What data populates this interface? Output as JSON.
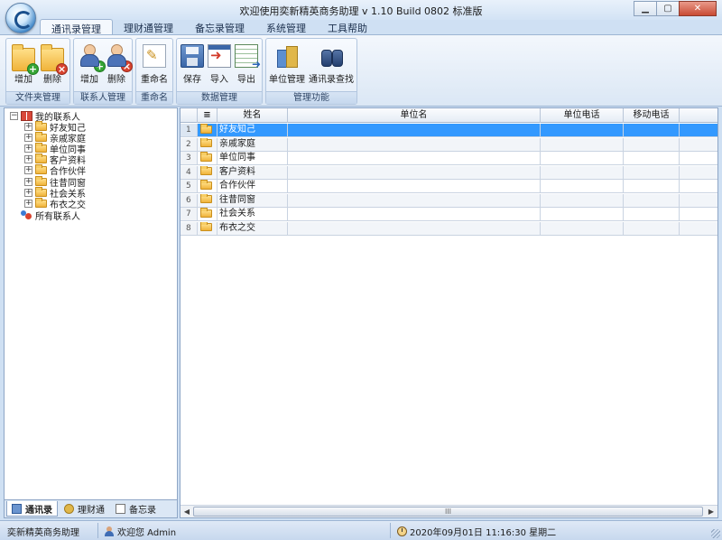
{
  "window": {
    "title": "欢迎使用奕新精英商务助理  v 1.10 Build 0802  标准版",
    "controls": {
      "minimize": "▁",
      "maximize": "▢",
      "close": "✕"
    }
  },
  "ribbon": {
    "tabs": [
      "通讯录管理",
      "理财通管理",
      "备忘录管理",
      "系统管理",
      "工具帮助"
    ],
    "active_tab": 0,
    "groups": {
      "folder_mgmt": {
        "label": "文件夹管理",
        "add": "增加",
        "delete": "删除"
      },
      "contact_mgmt": {
        "label": "联系人管理",
        "add": "增加",
        "delete": "删除"
      },
      "rename": {
        "label": "重命名",
        "rename": "重命名"
      },
      "data_mgmt": {
        "label": "数据管理",
        "save": "保存",
        "import": "导入",
        "export": "导出"
      },
      "manage_funcs": {
        "label": "管理功能",
        "unit_mgmt": "单位管理",
        "search": "通讯录查找"
      }
    }
  },
  "tree": {
    "root": "我的联系人",
    "folders": [
      "好友知己",
      "亲戚家庭",
      "单位同事",
      "客户资料",
      "合作伙伴",
      "往昔同窗",
      "社会关系",
      "布衣之交"
    ],
    "all_contacts": "所有联系人"
  },
  "left_tabs": [
    "通讯录",
    "理财通",
    "备忘录"
  ],
  "grid": {
    "columns": [
      "姓名",
      "单位名",
      "单位电话",
      "移动电话"
    ],
    "rows": [
      {
        "num": "1",
        "name": "好友知己"
      },
      {
        "num": "2",
        "name": "亲戚家庭"
      },
      {
        "num": "3",
        "name": "单位同事"
      },
      {
        "num": "4",
        "name": "客户资料"
      },
      {
        "num": "5",
        "name": "合作伙伴"
      },
      {
        "num": "6",
        "name": "往昔同窗"
      },
      {
        "num": "7",
        "name": "社会关系"
      },
      {
        "num": "8",
        "name": "布衣之交"
      }
    ],
    "selected_row": 0,
    "scroll_thumb_text": "III"
  },
  "status": {
    "app_name": "奕新精英商务助理",
    "welcome": "欢迎您 Admin",
    "datetime": "2020年09月01日 11:16:30 星期二"
  }
}
